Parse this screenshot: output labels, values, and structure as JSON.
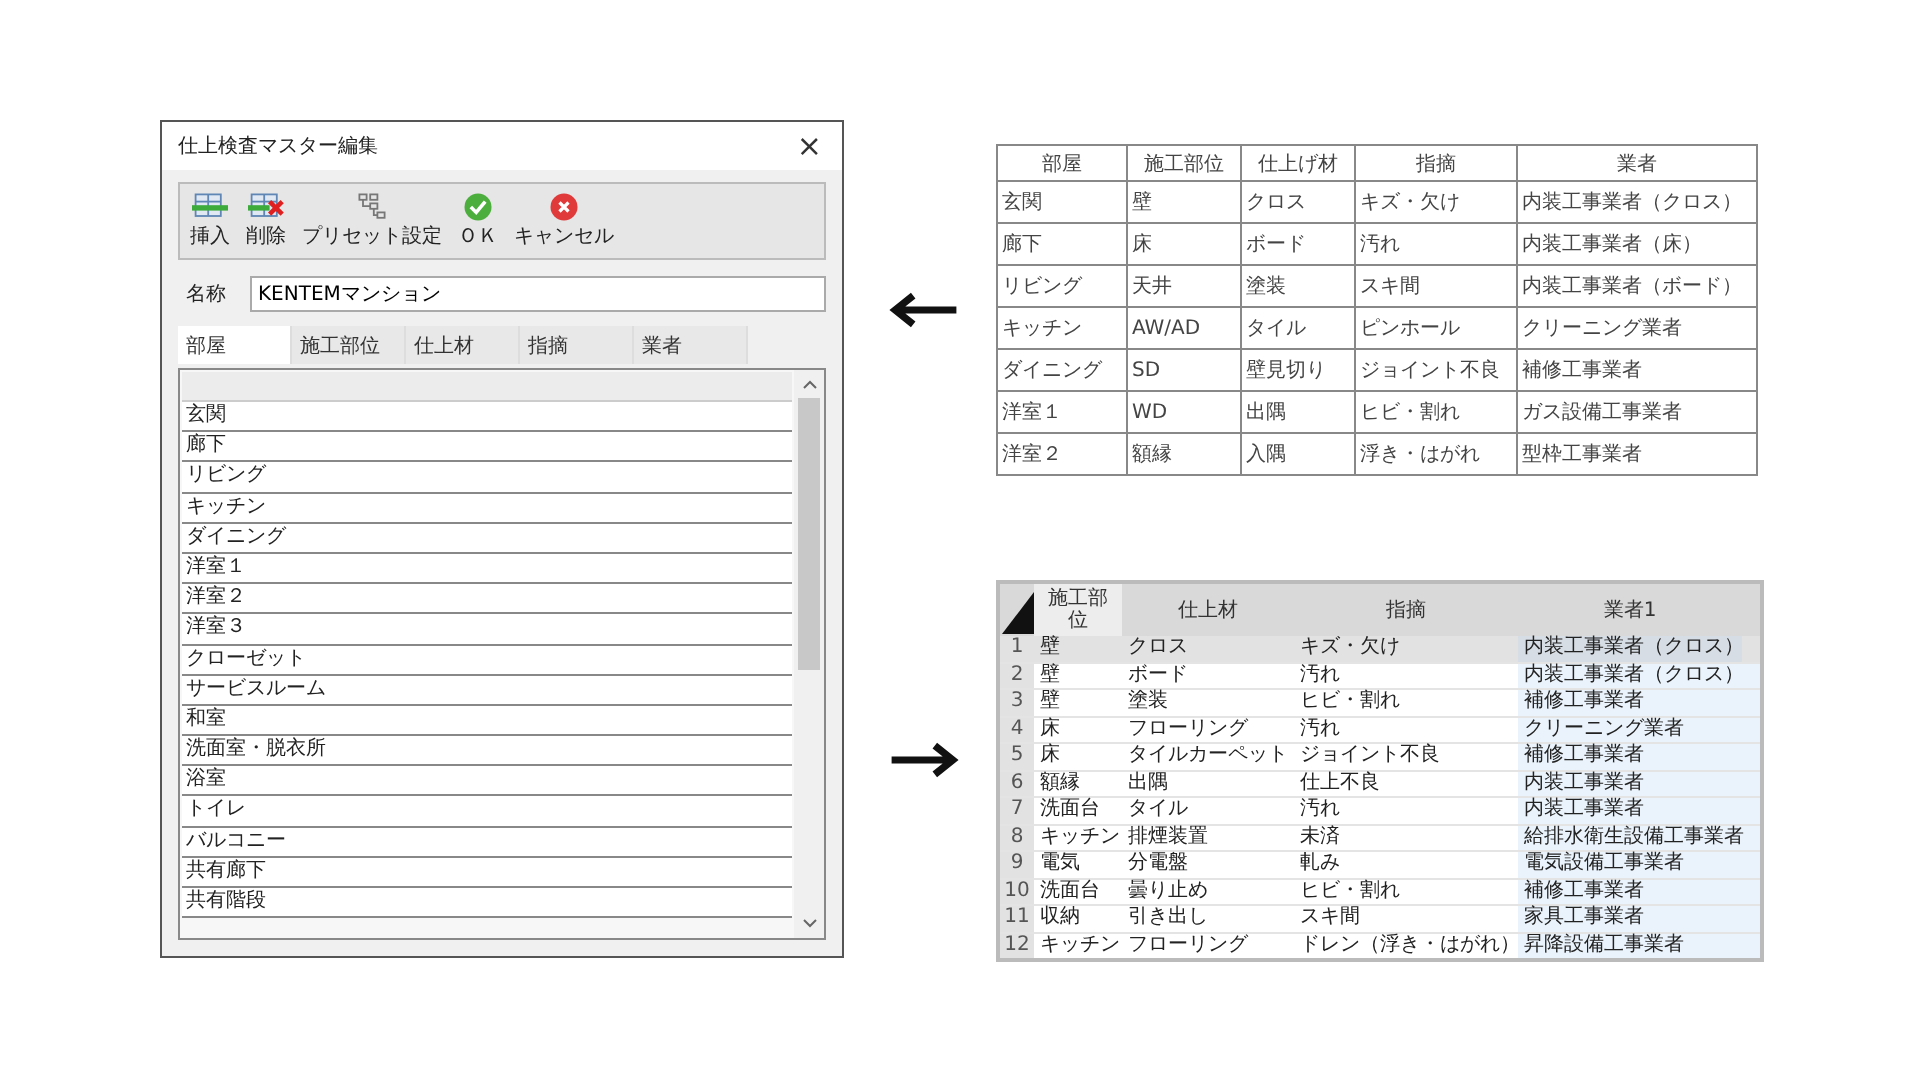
{
  "dialog": {
    "title": "仕上検査マスター編集",
    "close": "×",
    "toolbar": [
      {
        "kind": "insert",
        "label": "挿入"
      },
      {
        "kind": "delete",
        "label": "削除"
      },
      {
        "kind": "preset",
        "label": "プリセット設定"
      },
      {
        "kind": "ok",
        "label": "ＯＫ"
      },
      {
        "kind": "cancel",
        "label": "キャンセル"
      }
    ],
    "name_field": {
      "label": "名称",
      "value": "KENTEMマンション"
    },
    "tabs": [
      {
        "label": "部屋",
        "selected": true
      },
      {
        "label": "施工部位",
        "selected": false
      },
      {
        "label": "仕上材",
        "selected": false
      },
      {
        "label": "指摘",
        "selected": false
      },
      {
        "label": "業者",
        "selected": false
      }
    ],
    "list": {
      "items": [
        "玄関",
        "廊下",
        "リビング",
        "キッチン",
        "ダイニング",
        "洋室１",
        "洋室２",
        "洋室３",
        "クローゼット",
        "サービスルーム",
        "和室",
        "洗面室・脱衣所",
        "浴室",
        "トイレ",
        "バルコニー",
        "共有廊下",
        "共有階段"
      ]
    }
  },
  "master_table": {
    "columns": [
      "部屋",
      "施工部位",
      "仕上げ材",
      "指摘",
      "業者"
    ],
    "rows": [
      [
        "玄関",
        "壁",
        "クロス",
        "キズ・欠け",
        "内装工事業者（クロス）"
      ],
      [
        "廊下",
        "床",
        "ボード",
        "汚れ",
        "内装工事業者（床）"
      ],
      [
        "リビング",
        "天井",
        "塗装",
        "スキ間",
        "内装工事業者（ボード）"
      ],
      [
        "キッチン",
        "AW/AD",
        "タイル",
        "ピンホール",
        "クリーニング業者"
      ],
      [
        "ダイニング",
        "SD",
        "壁見切り",
        "ジョイント不良",
        "補修工事業者"
      ],
      [
        "洋室１",
        "WD",
        "出隅",
        "ヒビ・割れ",
        "ガス設備工事業者"
      ],
      [
        "洋室２",
        "額縁",
        "入隅",
        "浮き・はがれ",
        "型枠工事業者"
      ]
    ]
  },
  "spreadsheet": {
    "columns": [
      {
        "label": "施工部位",
        "selected": false
      },
      {
        "label": "仕上材",
        "selected": false
      },
      {
        "label": "指摘",
        "selected": false
      },
      {
        "label": "業者1",
        "selected": true
      }
    ],
    "rows": [
      {
        "number": "1",
        "selected": true,
        "cells": [
          "壁",
          "クロス",
          "キズ・欠け",
          "内装工事業者（クロス）"
        ]
      },
      {
        "number": "2",
        "selected": false,
        "cells": [
          "壁",
          "ボード",
          "汚れ",
          "内装工事業者（クロス）"
        ]
      },
      {
        "number": "3",
        "selected": false,
        "cells": [
          "壁",
          "塗装",
          "ヒビ・割れ",
          "補修工事業者"
        ]
      },
      {
        "number": "4",
        "selected": false,
        "cells": [
          "床",
          "フローリング",
          "汚れ",
          "クリーニング業者"
        ]
      },
      {
        "number": "5",
        "selected": false,
        "cells": [
          "床",
          "タイルカーペット",
          "ジョイント不良",
          "補修工事業者"
        ]
      },
      {
        "number": "6",
        "selected": false,
        "cells": [
          "額縁",
          "出隅",
          "仕上不良",
          "内装工事業者"
        ]
      },
      {
        "number": "7",
        "selected": false,
        "cells": [
          "洗面台",
          "タイル",
          "汚れ",
          "内装工事業者"
        ]
      },
      {
        "number": "8",
        "selected": false,
        "cells": [
          "キッチン",
          "排煙装置",
          "未済",
          "給排水衛生設備工事業者"
        ]
      },
      {
        "number": "9",
        "selected": false,
        "cells": [
          "電気",
          "分電盤",
          "軋み",
          "電気設備工事業者"
        ]
      },
      {
        "number": "10",
        "selected": false,
        "cells": [
          "洗面台",
          "曇り止め",
          "ヒビ・割れ",
          "補修工事業者"
        ]
      },
      {
        "number": "11",
        "selected": false,
        "cells": [
          "収納",
          "引き出し",
          "スキ間",
          "家具工事業者"
        ]
      },
      {
        "number": "12",
        "selected": false,
        "cells": [
          "キッチン",
          "フローリング",
          "ドレン（浮き・はがれ）",
          "昇降設備工事業者"
        ]
      }
    ]
  }
}
